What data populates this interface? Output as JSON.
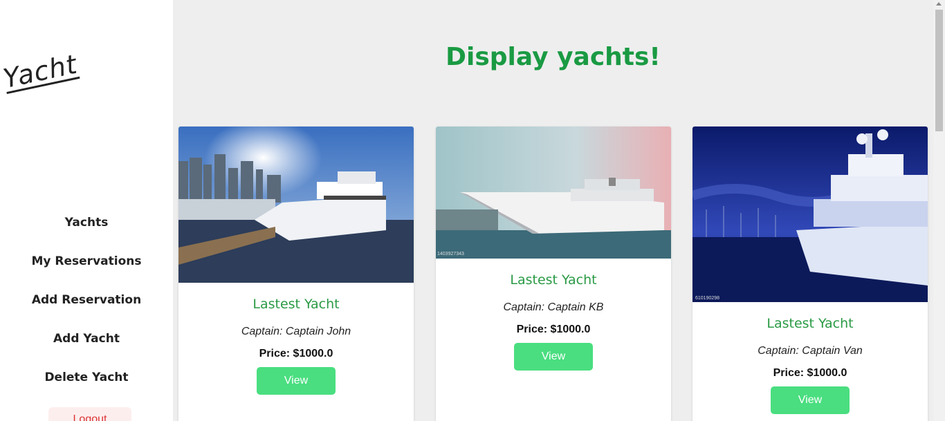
{
  "sidebar": {
    "logo": "Yacht",
    "items": [
      {
        "label": "Yachts"
      },
      {
        "label": "My Reservations"
      },
      {
        "label": "Add Reservation"
      },
      {
        "label": "Add Yacht"
      },
      {
        "label": "Delete Yacht"
      }
    ],
    "logout_label": "Logout"
  },
  "main": {
    "title": "Display yachts!",
    "cards": [
      {
        "title": "Lastest Yacht",
        "captain": "Captain: Captain John",
        "price": "Price: $1000.0",
        "button": "View"
      },
      {
        "title": "Lastest Yacht",
        "captain": "Captain: Captain KB",
        "price": "Price: $1000.0",
        "button": "View",
        "watermark": "1403927343"
      },
      {
        "title": "Lastest Yacht",
        "captain": "Captain: Captain Van",
        "price": "Price: $1000.0",
        "button": "View",
        "watermark": "610190298"
      }
    ]
  },
  "colors": {
    "accent": "#1a9a43",
    "button": "#4ade80",
    "logout_text": "#dd3333",
    "background": "#eeeeee"
  }
}
